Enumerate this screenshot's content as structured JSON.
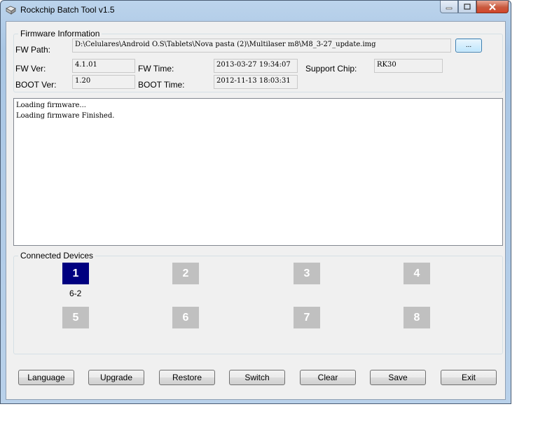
{
  "window": {
    "title": "Rockchip Batch Tool v1.5"
  },
  "firmware": {
    "group_title": "Firmware Information",
    "fw_path_label": "FW Path:",
    "fw_path_value": "D:\\Celulares\\Android O.S\\Tablets\\Nova pasta (2)\\Multilaser m8\\M8_3-27_update.img",
    "browse_label": "...",
    "fw_ver_label": "FW Ver:",
    "fw_ver_value": "4.1.01",
    "fw_time_label": "FW Time:",
    "fw_time_value": "2013-03-27 19:34:07",
    "support_chip_label": "Support Chip:",
    "support_chip_value": "RK30",
    "boot_ver_label": "BOOT Ver:",
    "boot_ver_value": "1.20",
    "boot_time_label": "BOOT Time:",
    "boot_time_value": "2012-11-13 18:03:31"
  },
  "log": {
    "lines": [
      "Loading firmware...",
      "Loading firmware Finished."
    ]
  },
  "devices": {
    "group_title": "Connected Devices",
    "slots": [
      {
        "number": "1",
        "active": true,
        "sub": "6-2"
      },
      {
        "number": "2",
        "active": false,
        "sub": ""
      },
      {
        "number": "3",
        "active": false,
        "sub": ""
      },
      {
        "number": "4",
        "active": false,
        "sub": ""
      },
      {
        "number": "5",
        "active": false,
        "sub": ""
      },
      {
        "number": "6",
        "active": false,
        "sub": ""
      },
      {
        "number": "7",
        "active": false,
        "sub": ""
      },
      {
        "number": "8",
        "active": false,
        "sub": ""
      }
    ]
  },
  "buttons": {
    "language": "Language",
    "upgrade": "Upgrade",
    "restore": "Restore",
    "switch": "Switch",
    "clear": "Clear",
    "save": "Save",
    "exit": "Exit"
  },
  "colors": {
    "active_device": "#000080",
    "inactive_device": "#c0c0c0"
  }
}
